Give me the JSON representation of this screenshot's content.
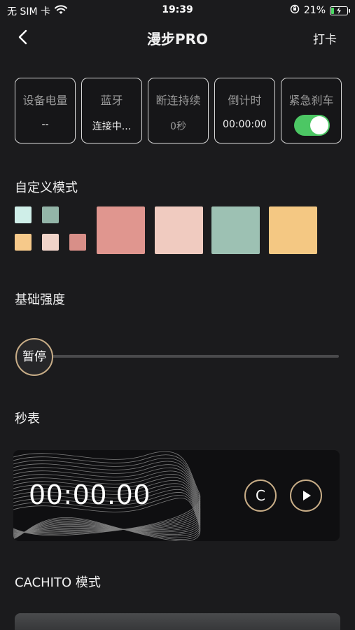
{
  "status_bar": {
    "carrier": "无 SIM 卡",
    "time": "19:39",
    "battery_percent": "21%",
    "battery_level": 0.21
  },
  "nav": {
    "title": "漫步PRO",
    "checkin_label": "打卡"
  },
  "cards": [
    {
      "label": "设备电量",
      "value": "--"
    },
    {
      "label": "蓝牙",
      "value": "连接中..."
    },
    {
      "label": "断连持续",
      "value": "0秒"
    },
    {
      "label": "倒计时",
      "value": "00:00:00"
    },
    {
      "label": "紧急刹车",
      "toggle_on": true
    }
  ],
  "custom_mode": {
    "title": "自定义模式",
    "small_swatches": [
      "#cfeee8",
      "#93b5a8",
      "#f6c98a",
      "#f0d3c8",
      "#d88f88"
    ],
    "large_swatches": [
      "#e0968f",
      "#f0cbc0",
      "#9dc1b3",
      "#f4c883"
    ]
  },
  "intensity": {
    "title": "基础强度",
    "thumb_label": "暂停",
    "level": 0
  },
  "stopwatch": {
    "title": "秒表",
    "time": "00:00.00",
    "clear_label": "C"
  },
  "cachito": {
    "title": "CACHITO 模式"
  },
  "colors": {
    "accent_gold": "#c8ad87",
    "toggle_green": "#4cc764"
  }
}
